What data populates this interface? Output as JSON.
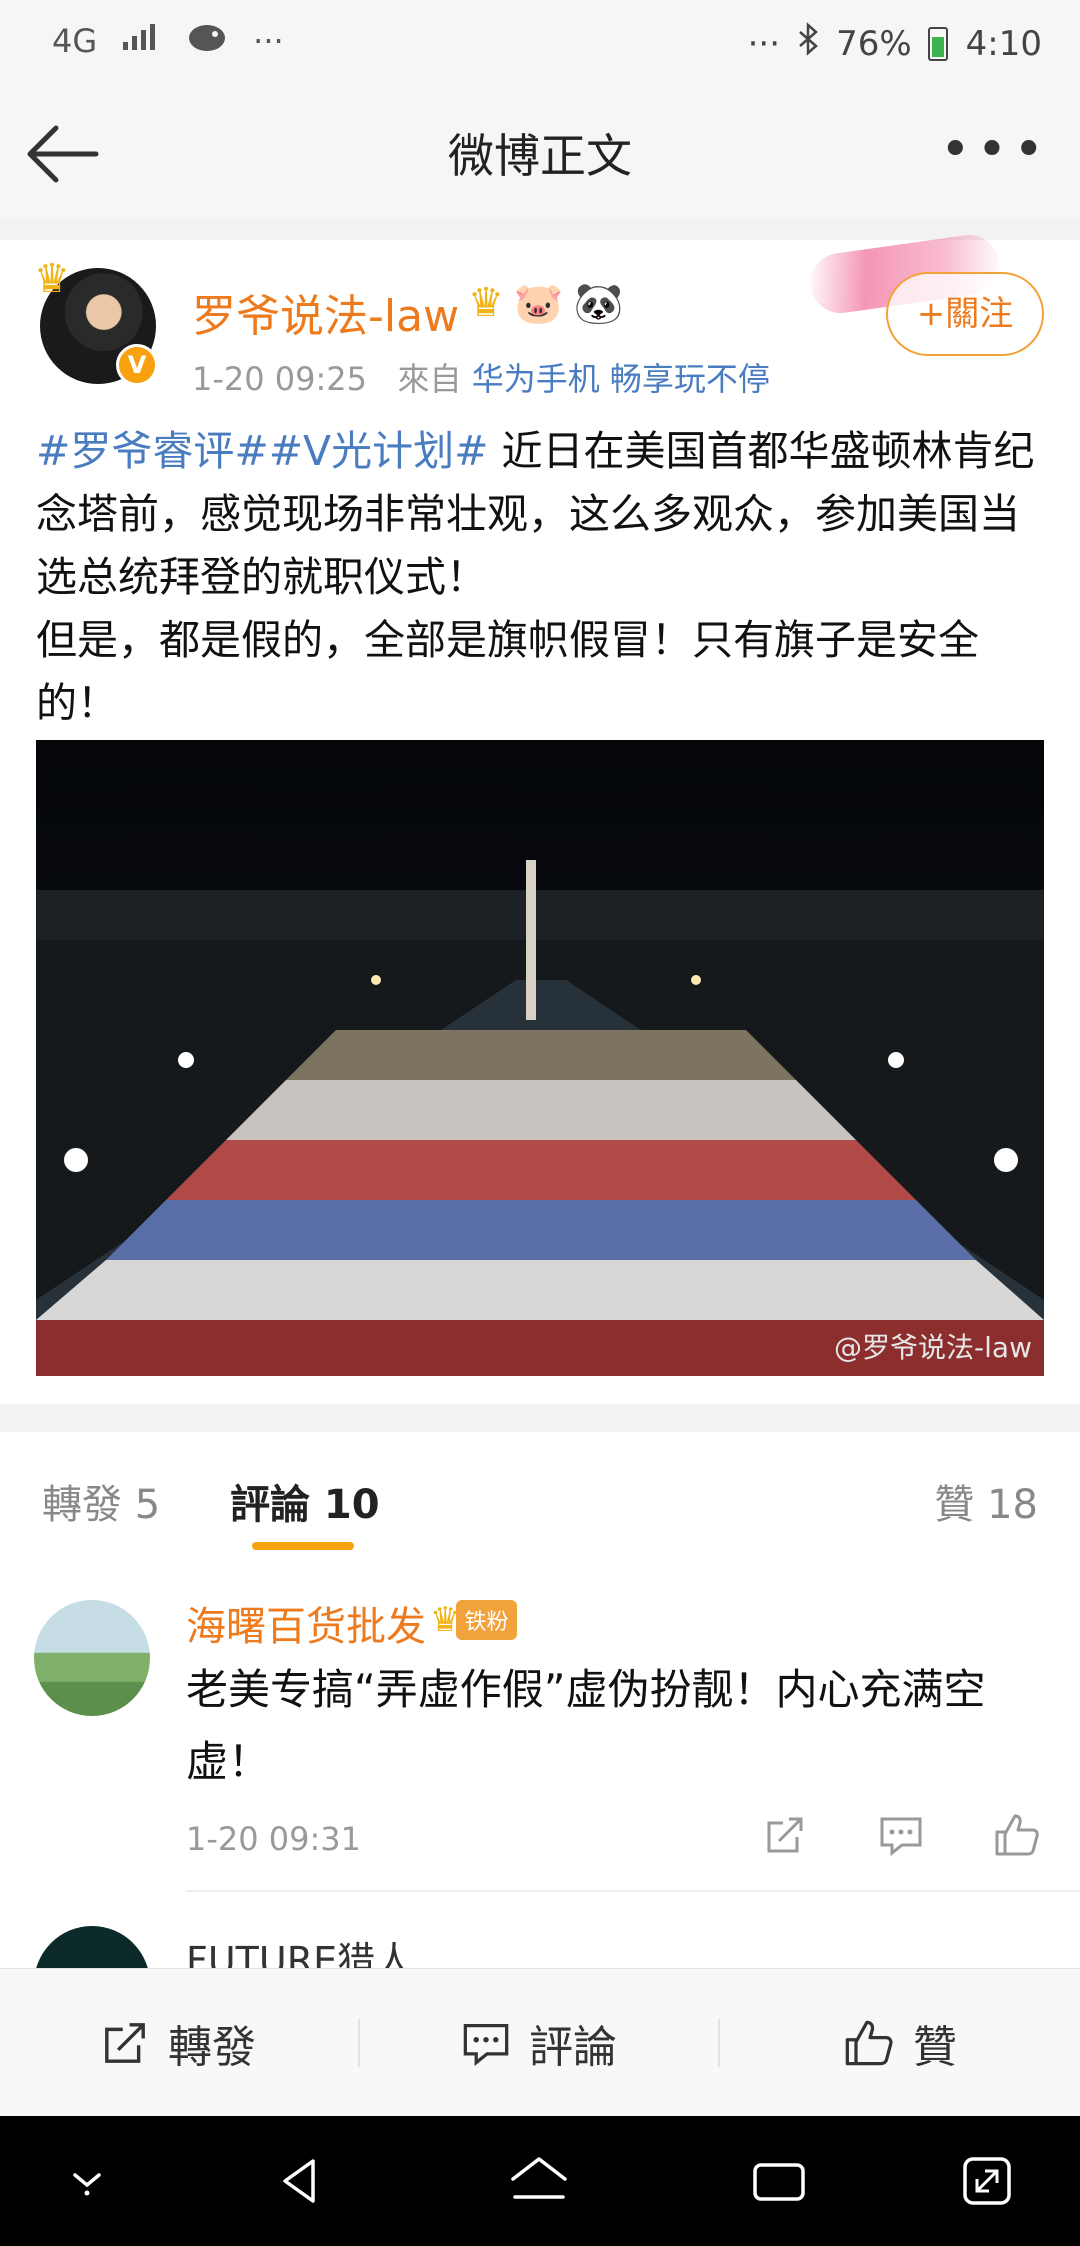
{
  "status_bar": {
    "network": "4G",
    "more": "···",
    "right_more": "···",
    "battery": "76%",
    "time": "4:10"
  },
  "header": {
    "title": "微博正文"
  },
  "post": {
    "username": "罗爷说法-law",
    "timestamp": "1-20 09:25",
    "source_prefix": "來自",
    "source": "华为手机 畅享玩不停",
    "follow_label": "+關注",
    "hashtags": "#罗爷睿评##V光计划#",
    "body_1": " 近日在美国首都华盛顿林肯纪念塔前，感觉现场非常壮观，这么多观众，参加美国当选总统拜登的就职仪式！",
    "body_2": "但是，都是假的，全部是旗帜假冒！只有旗子是安全的！",
    "image_watermark": "@罗爷说法-law"
  },
  "tabs": {
    "repost": "轉發 5",
    "comments": "評論 10",
    "likes": "贊 18"
  },
  "comments": [
    {
      "user": "海曙百货批发",
      "badge": "铁粉",
      "text": "老美专搞“弄虚作假”虚伪扮靓！内心充满空虚！",
      "time": "1-20 09:31"
    },
    {
      "user": "FUTURE猎人"
    }
  ],
  "action_bar": {
    "repost": "轉發",
    "comment": "評論",
    "like": "贊"
  },
  "colors": {
    "accent": "#ee7a1e",
    "link": "#4a7cc0",
    "tab_indicator": "#f7a10f"
  }
}
